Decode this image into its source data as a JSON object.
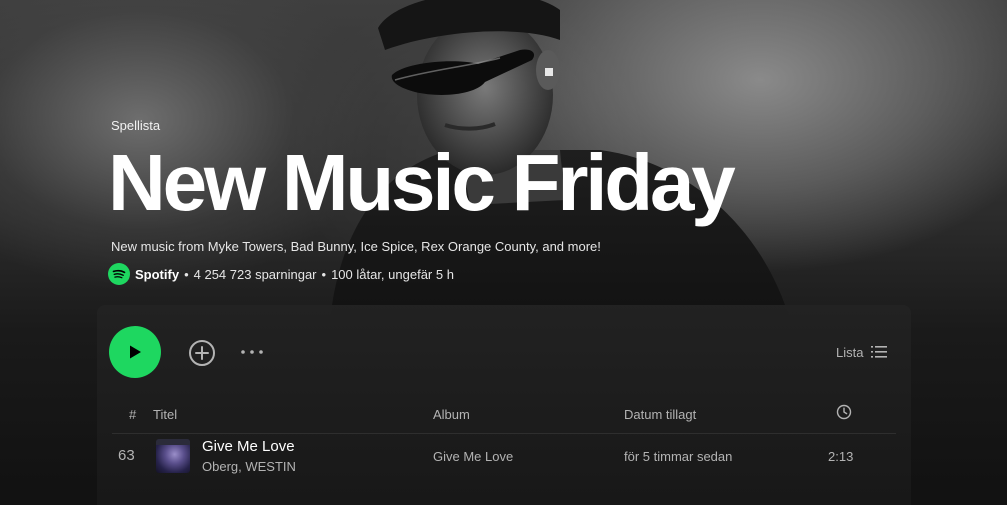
{
  "playlist": {
    "type_label": "Spellista",
    "title": "New Music Friday",
    "description": "New music from Myke Towers, Bad Bunny, Ice Spice, Rex Orange County, and more!",
    "owner": "Spotify",
    "saves": "4 254 723 sparningar",
    "summary": "100 låtar, ungefär 5 h",
    "separator": "•"
  },
  "controls": {
    "play_icon": "play-icon",
    "add_icon": "add-circle-icon",
    "more_icon": "more-horizontal-icon",
    "view_label": "Lista",
    "view_icon": "list-view-icon"
  },
  "table": {
    "columns": {
      "number": "#",
      "title": "Titel",
      "album": "Album",
      "date_added": "Datum tillagt",
      "duration_icon": "clock-icon"
    },
    "tracks": [
      {
        "number": "63",
        "title": "Give Me Love",
        "artists": "Oberg, WESTIN",
        "album": "Give Me Love",
        "date_added": "för 5 timmar sedan",
        "duration": "2:13"
      }
    ]
  },
  "colors": {
    "accent": "#1ed760",
    "background": "#121212",
    "text_primary": "#ffffff",
    "text_secondary": "#b3b3b3"
  }
}
